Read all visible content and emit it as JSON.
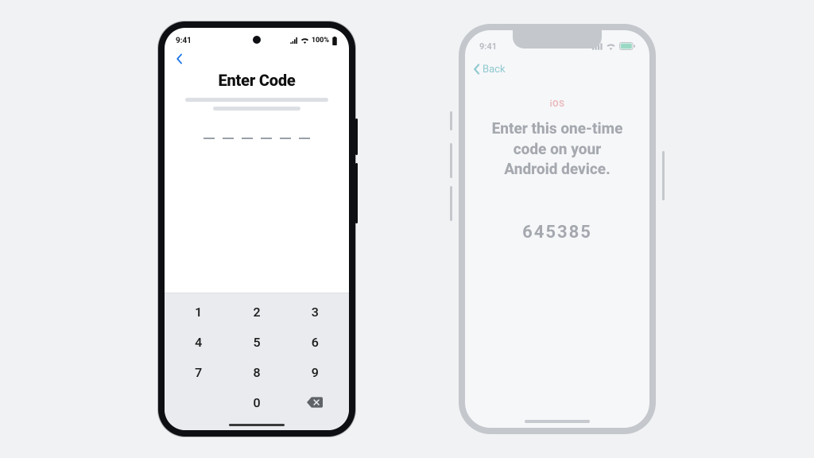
{
  "android": {
    "statusbar": {
      "time": "9:41",
      "battery_text": "100%"
    },
    "title": "Enter Code",
    "code_length": 6,
    "keypad": {
      "keys": [
        "1",
        "2",
        "3",
        "4",
        "5",
        "6",
        "7",
        "8",
        "9",
        "",
        "0"
      ],
      "backspace_name": "backspace-icon"
    }
  },
  "ios": {
    "statusbar": {
      "time": "9:41"
    },
    "back_label": "Back",
    "subtitle": "iOS",
    "headline": "Enter this one-time code on your Android device.",
    "code": "645385"
  }
}
